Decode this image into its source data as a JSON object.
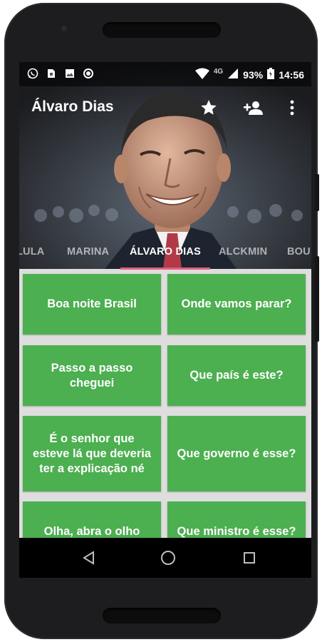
{
  "status_bar": {
    "icons_left": [
      "whatsapp-icon",
      "sim-card-icon",
      "image-icon",
      "circle-icon"
    ],
    "network": "4G",
    "battery": "93%",
    "time": "14:56"
  },
  "toolbar": {
    "title": "Álvaro Dias",
    "actions": [
      "star-icon",
      "add-person-icon",
      "more-vert-icon"
    ]
  },
  "tabs": [
    {
      "label": "LULA",
      "active": false
    },
    {
      "label": "MARINA",
      "active": false
    },
    {
      "label": "ÁLVARO DIAS",
      "active": true
    },
    {
      "label": "ALCKMIN",
      "active": false
    },
    {
      "label": "BOU",
      "active": false
    }
  ],
  "cards": [
    "Boa noite Brasil",
    "Onde vamos parar?",
    "Passo a passo cheguei",
    "Que país é este?",
    "É o senhor que esteve lá que deveria ter a explicação né",
    "Que governo é esse?",
    "Olha, abra o olho",
    "Que ministro é esse?"
  ],
  "colors": {
    "card_green": "#4caf50",
    "tab_indicator": "#e0607e",
    "grid_background": "#dedede"
  }
}
